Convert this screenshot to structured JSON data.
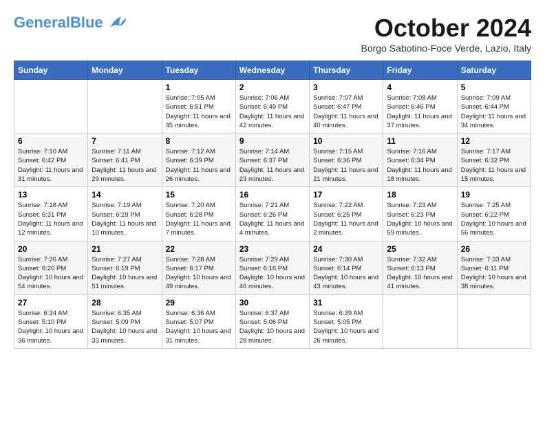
{
  "header": {
    "logo": {
      "general": "General",
      "blue": "Blue"
    },
    "title": "October 2024",
    "location": "Borgo Sabotino-Foce Verde, Lazio, Italy"
  },
  "days_of_week": [
    "Sunday",
    "Monday",
    "Tuesday",
    "Wednesday",
    "Thursday",
    "Friday",
    "Saturday"
  ],
  "weeks": [
    [
      {
        "day": "",
        "sunrise": "",
        "sunset": "",
        "daylight": ""
      },
      {
        "day": "",
        "sunrise": "",
        "sunset": "",
        "daylight": ""
      },
      {
        "day": "1",
        "sunrise": "Sunrise: 7:05 AM",
        "sunset": "Sunset: 6:51 PM",
        "daylight": "Daylight: 11 hours and 45 minutes."
      },
      {
        "day": "2",
        "sunrise": "Sunrise: 7:06 AM",
        "sunset": "Sunset: 6:49 PM",
        "daylight": "Daylight: 11 hours and 42 minutes."
      },
      {
        "day": "3",
        "sunrise": "Sunrise: 7:07 AM",
        "sunset": "Sunset: 6:47 PM",
        "daylight": "Daylight: 11 hours and 40 minutes."
      },
      {
        "day": "4",
        "sunrise": "Sunrise: 7:08 AM",
        "sunset": "Sunset: 6:46 PM",
        "daylight": "Daylight: 11 hours and 37 minutes."
      },
      {
        "day": "5",
        "sunrise": "Sunrise: 7:09 AM",
        "sunset": "Sunset: 6:44 PM",
        "daylight": "Daylight: 11 hours and 34 minutes."
      }
    ],
    [
      {
        "day": "6",
        "sunrise": "Sunrise: 7:10 AM",
        "sunset": "Sunset: 6:42 PM",
        "daylight": "Daylight: 11 hours and 31 minutes."
      },
      {
        "day": "7",
        "sunrise": "Sunrise: 7:11 AM",
        "sunset": "Sunset: 6:41 PM",
        "daylight": "Daylight: 11 hours and 29 minutes."
      },
      {
        "day": "8",
        "sunrise": "Sunrise: 7:12 AM",
        "sunset": "Sunset: 6:39 PM",
        "daylight": "Daylight: 11 hours and 26 minutes."
      },
      {
        "day": "9",
        "sunrise": "Sunrise: 7:14 AM",
        "sunset": "Sunset: 6:37 PM",
        "daylight": "Daylight: 11 hours and 23 minutes."
      },
      {
        "day": "10",
        "sunrise": "Sunrise: 7:15 AM",
        "sunset": "Sunset: 6:36 PM",
        "daylight": "Daylight: 11 hours and 21 minutes."
      },
      {
        "day": "11",
        "sunrise": "Sunrise: 7:16 AM",
        "sunset": "Sunset: 6:34 PM",
        "daylight": "Daylight: 11 hours and 18 minutes."
      },
      {
        "day": "12",
        "sunrise": "Sunrise: 7:17 AM",
        "sunset": "Sunset: 6:32 PM",
        "daylight": "Daylight: 11 hours and 15 minutes."
      }
    ],
    [
      {
        "day": "13",
        "sunrise": "Sunrise: 7:18 AM",
        "sunset": "Sunset: 6:31 PM",
        "daylight": "Daylight: 11 hours and 12 minutes."
      },
      {
        "day": "14",
        "sunrise": "Sunrise: 7:19 AM",
        "sunset": "Sunset: 6:29 PM",
        "daylight": "Daylight: 11 hours and 10 minutes."
      },
      {
        "day": "15",
        "sunrise": "Sunrise: 7:20 AM",
        "sunset": "Sunset: 6:28 PM",
        "daylight": "Daylight: 11 hours and 7 minutes."
      },
      {
        "day": "16",
        "sunrise": "Sunrise: 7:21 AM",
        "sunset": "Sunset: 6:26 PM",
        "daylight": "Daylight: 11 hours and 4 minutes."
      },
      {
        "day": "17",
        "sunrise": "Sunrise: 7:22 AM",
        "sunset": "Sunset: 6:25 PM",
        "daylight": "Daylight: 11 hours and 2 minutes."
      },
      {
        "day": "18",
        "sunrise": "Sunrise: 7:23 AM",
        "sunset": "Sunset: 6:23 PM",
        "daylight": "Daylight: 10 hours and 59 minutes."
      },
      {
        "day": "19",
        "sunrise": "Sunrise: 7:25 AM",
        "sunset": "Sunset: 6:22 PM",
        "daylight": "Daylight: 10 hours and 56 minutes."
      }
    ],
    [
      {
        "day": "20",
        "sunrise": "Sunrise: 7:26 AM",
        "sunset": "Sunset: 6:20 PM",
        "daylight": "Daylight: 10 hours and 54 minutes."
      },
      {
        "day": "21",
        "sunrise": "Sunrise: 7:27 AM",
        "sunset": "Sunset: 6:19 PM",
        "daylight": "Daylight: 10 hours and 51 minutes."
      },
      {
        "day": "22",
        "sunrise": "Sunrise: 7:28 AM",
        "sunset": "Sunset: 6:17 PM",
        "daylight": "Daylight: 10 hours and 49 minutes."
      },
      {
        "day": "23",
        "sunrise": "Sunrise: 7:29 AM",
        "sunset": "Sunset: 6:16 PM",
        "daylight": "Daylight: 10 hours and 46 minutes."
      },
      {
        "day": "24",
        "sunrise": "Sunrise: 7:30 AM",
        "sunset": "Sunset: 6:14 PM",
        "daylight": "Daylight: 10 hours and 43 minutes."
      },
      {
        "day": "25",
        "sunrise": "Sunrise: 7:32 AM",
        "sunset": "Sunset: 6:13 PM",
        "daylight": "Daylight: 10 hours and 41 minutes."
      },
      {
        "day": "26",
        "sunrise": "Sunrise: 7:33 AM",
        "sunset": "Sunset: 6:11 PM",
        "daylight": "Daylight: 10 hours and 38 minutes."
      }
    ],
    [
      {
        "day": "27",
        "sunrise": "Sunrise: 6:34 AM",
        "sunset": "Sunset: 5:10 PM",
        "daylight": "Daylight: 10 hours and 36 minutes."
      },
      {
        "day": "28",
        "sunrise": "Sunrise: 6:35 AM",
        "sunset": "Sunset: 5:09 PM",
        "daylight": "Daylight: 10 hours and 33 minutes."
      },
      {
        "day": "29",
        "sunrise": "Sunrise: 6:36 AM",
        "sunset": "Sunset: 5:07 PM",
        "daylight": "Daylight: 10 hours and 31 minutes."
      },
      {
        "day": "30",
        "sunrise": "Sunrise: 6:37 AM",
        "sunset": "Sunset: 5:06 PM",
        "daylight": "Daylight: 10 hours and 28 minutes."
      },
      {
        "day": "31",
        "sunrise": "Sunrise: 6:39 AM",
        "sunset": "Sunset: 5:05 PM",
        "daylight": "Daylight: 10 hours and 26 minutes."
      },
      {
        "day": "",
        "sunrise": "",
        "sunset": "",
        "daylight": ""
      },
      {
        "day": "",
        "sunrise": "",
        "sunset": "",
        "daylight": ""
      }
    ]
  ]
}
